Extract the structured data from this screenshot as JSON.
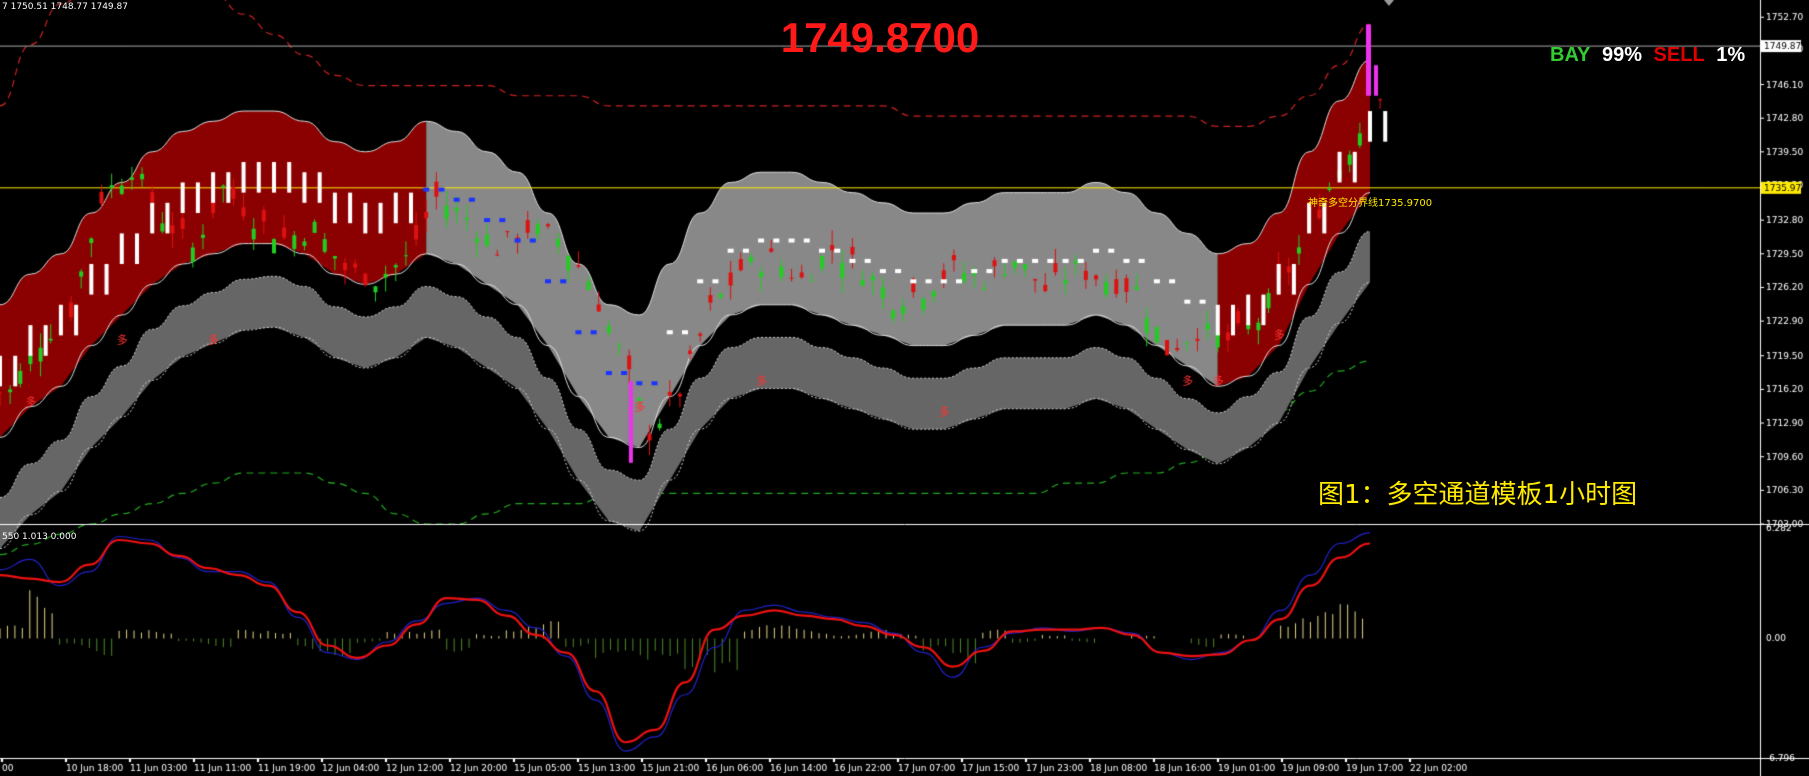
{
  "header": {
    "ohlc_text": "7 1750.51 1748.77 1749.87",
    "big_price": "1749.8700"
  },
  "signal": {
    "buy_label": "BAY",
    "buy_pct": "99%",
    "sell_label": "SELL",
    "sell_pct": "1%"
  },
  "caption": "图1：多空通道模板1小时图",
  "boundary_label": "神奇多空分界线1735.9700",
  "indicator_info": "550 1.013 0.000",
  "colors": {
    "background": "#000000",
    "grid": "#ffffff",
    "bull_candle": "#22cc22",
    "bear_candle": "#dd1111",
    "upper_band_fill": "#8b0000",
    "neutral_band_fill": "#888888",
    "lower_channel_fill": "#666666",
    "outer_upper_line": "#cc2222",
    "outer_lower_line": "#22aa22",
    "boundary_line": "#ffea00",
    "macd_line": "#2222cc",
    "signal_line": "#ee1111",
    "hist_positive": "#e6d48a",
    "hist_negative": "#4f8a2a",
    "white_bars": "#ffffff",
    "magenta_bars": "#ee33ee"
  },
  "chart_data": [
    {
      "type": "line",
      "name": "price_panel",
      "y_axis_ticks": [
        "1752.70",
        "1749.60",
        "1746.10",
        "1742.80",
        "1739.50",
        "1736.20",
        "1732.80",
        "1729.50",
        "1726.20",
        "1722.90",
        "1719.50",
        "1716.20",
        "1712.90",
        "1709.60",
        "1706.30",
        "1703.00"
      ],
      "ylim": [
        1703.0,
        1754.0
      ],
      "x_ticks": [
        "00",
        "10 Jun 18:00",
        "11 Jun 03:00",
        "11 Jun 11:00",
        "11 Jun 19:00",
        "12 Jun 04:00",
        "12 Jun 12:00",
        "12 Jun 20:00",
        "15 Jun 05:00",
        "15 Jun 13:00",
        "15 Jun 21:00",
        "16 Jun 06:00",
        "16 Jun 14:00",
        "16 Jun 22:00",
        "17 Jun 07:00",
        "17 Jun 15:00",
        "17 Jun 23:00",
        "18 Jun 08:00",
        "18 Jun 16:00",
        "19 Jun 01:00",
        "19 Jun 09:00",
        "19 Jun 17:00",
        "22 Jun 02:00"
      ],
      "price_labels": {
        "current": "1749.87",
        "boundary": "1735.97"
      },
      "last_price": 1749.87,
      "boundary_price": 1735.97,
      "signal_marker": "多",
      "channel_mid": [
        1718,
        1721,
        1723,
        1727,
        1730,
        1733,
        1735,
        1736,
        1737,
        1737,
        1736,
        1734,
        1733,
        1734,
        1736,
        1735,
        1733,
        1731,
        1727,
        1722,
        1718,
        1717,
        1722,
        1727,
        1730,
        1731,
        1731,
        1730,
        1729,
        1728,
        1727,
        1727,
        1728,
        1729,
        1729,
        1729,
        1730,
        1729,
        1727,
        1725,
        1723,
        1724,
        1727,
        1733,
        1738,
        1742
      ],
      "candles_close": [
        1716,
        1721,
        1724,
        1735,
        1738,
        1733,
        1730,
        1736,
        1733,
        1731,
        1732,
        1728,
        1727,
        1729,
        1735,
        1733,
        1730,
        1732,
        1731,
        1727,
        1720,
        1712,
        1716,
        1724,
        1728,
        1729,
        1727,
        1730,
        1728,
        1725,
        1726,
        1728,
        1727,
        1729,
        1726,
        1728,
        1727,
        1726,
        1720,
        1722,
        1721,
        1723,
        1728,
        1734,
        1740,
        1745
      ],
      "band_half_width": 6.5,
      "lower_channel_offset": [
        -13,
        -12,
        -11,
        -10,
        -10,
        -8,
        -7,
        -6,
        -5,
        -4,
        -4,
        -4,
        -4,
        -4,
        -4,
        -4,
        -4,
        -4,
        -4,
        -4,
        -4,
        -4,
        -4,
        -4,
        -4,
        -4,
        -4,
        -4,
        -4,
        -4,
        -4,
        -4,
        -4,
        -4,
        -4,
        -4,
        -4,
        -4,
        -4,
        -4,
        -2,
        0,
        -2,
        -4,
        -6,
        -6
      ],
      "outer_upper": [
        1744,
        1750,
        1754,
        1756,
        1757,
        1757,
        1756,
        1755,
        1753,
        1751,
        1749,
        1747,
        1746,
        1746,
        1746,
        1746,
        1746,
        1745,
        1745,
        1745,
        1744,
        1744,
        1744,
        1744,
        1744,
        1744,
        1744,
        1744,
        1744,
        1744,
        1743,
        1743,
        1743,
        1743,
        1743,
        1743,
        1743,
        1743,
        1743,
        1743,
        1742,
        1742,
        1743,
        1745,
        1748,
        1752
      ],
      "outer_lower": [
        1700,
        1701,
        1702,
        1703,
        1704,
        1705,
        1706,
        1707,
        1708,
        1708,
        1708,
        1707,
        1706,
        1704,
        1703,
        1703,
        1704,
        1705,
        1705,
        1705,
        1706,
        1706,
        1706,
        1706,
        1706,
        1706,
        1706,
        1706,
        1706,
        1706,
        1706,
        1706,
        1706,
        1706,
        1706,
        1707,
        1707,
        1708,
        1708,
        1709,
        1710,
        1712,
        1714,
        1716,
        1718,
        1719
      ]
    },
    {
      "type": "bar",
      "name": "oscillator_panel",
      "y_axis_ticks": [
        "6.282",
        "0.00",
        "-6.796"
      ],
      "ylim": [
        -6.796,
        6.282
      ],
      "series": [
        {
          "name": "macd",
          "values": [
            3.9,
            4.5,
            3.0,
            3.8,
            5.8,
            5.6,
            4.6,
            3.8,
            3.8,
            3.2,
            1.2,
            -0.8,
            -1.2,
            -0.2,
            1.0,
            2.0,
            2.3,
            1.6,
            0.6,
            -1.0,
            -3.5,
            -6.4,
            -5.6,
            -3.2,
            -0.5,
            1.6,
            1.9,
            1.5,
            1.2,
            0.9,
            0.3,
            -0.8,
            -2.2,
            -0.5,
            0.3,
            0.6,
            0.4,
            0.6,
            0.3,
            -0.8,
            -1.2,
            -0.8,
            -0.1,
            1.6,
            3.6,
            5.4,
            6.0
          ]
        },
        {
          "name": "signal",
          "values": [
            3.6,
            3.4,
            3.2,
            4.2,
            5.6,
            5.4,
            4.7,
            4.0,
            3.6,
            3.0,
            1.5,
            -0.4,
            -1.1,
            -0.4,
            0.8,
            2.3,
            2.2,
            1.3,
            0.2,
            -0.8,
            -3.0,
            -5.9,
            -5.2,
            -2.5,
            0.5,
            1.3,
            1.6,
            1.3,
            1.1,
            0.7,
            0.2,
            -0.5,
            -1.6,
            -0.7,
            0.4,
            0.5,
            0.5,
            0.6,
            0.2,
            -0.8,
            -1.0,
            -0.9,
            -0.1,
            1.1,
            3.0,
            4.6,
            5.4
          ]
        },
        {
          "name": "histogram",
          "values": [
            0.3,
            1.1,
            -0.2,
            -0.4,
            0.2,
            0.2,
            -0.1,
            -0.2,
            0.2,
            0.2,
            -0.3,
            -0.4,
            -0.1,
            0.2,
            0.2,
            -0.3,
            0.1,
            0.3,
            0.4,
            -0.2,
            -0.5,
            -0.5,
            -0.4,
            -0.7,
            -1.0,
            0.3,
            0.3,
            0.2,
            0.1,
            0.2,
            0.1,
            -0.3,
            -0.6,
            0.2,
            -0.1,
            0.1,
            -0.1,
            0.0,
            0.1,
            0.0,
            -0.2,
            0.1,
            0.0,
            0.5,
            0.6,
            0.8,
            0.6
          ]
        }
      ]
    }
  ]
}
